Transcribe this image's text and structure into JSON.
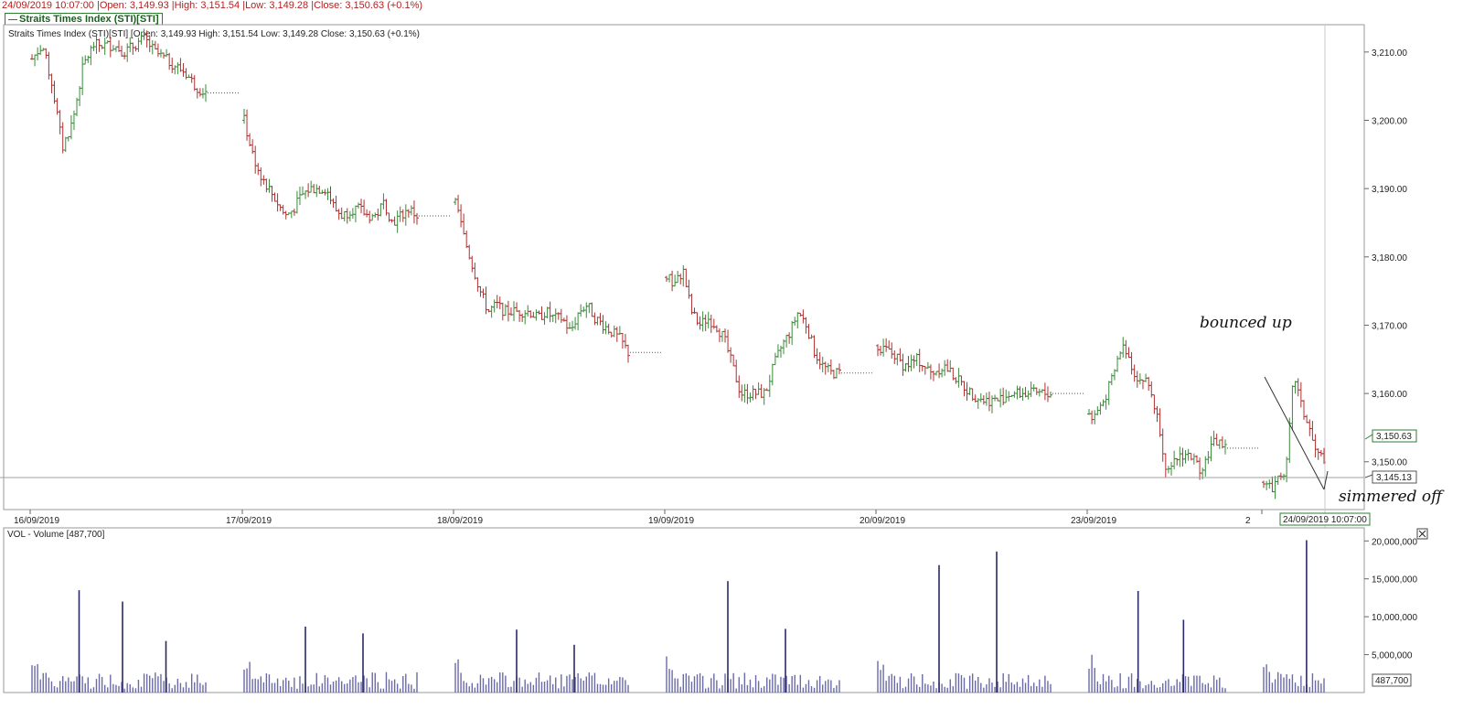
{
  "header": {
    "status_line": "24/09/2019 10:07:00 |Open: 3,149.93 |High: 3,151.54 |Low: 3,149.28 |Close: 3,150.63 (+0.1%)",
    "legend_label": "Straits Times Index (STI)[STI]"
  },
  "colors": {
    "up": "#3a8a3a",
    "down": "#b03030",
    "volume": "#6a6aa8",
    "volume_peak": "#2a2a66",
    "legend": "#2e7d32"
  },
  "chart_data": [
    {
      "type": "ohlc",
      "title": "Straits Times Index (STI)[STI] [Open: 3,149.93  High: 3,151.54  Low: 3,149.28  Close: 3,150.63  (+0.1%)",
      "ylim": [
        3143,
        3214
      ],
      "y_ticks": [
        "3,210.00",
        "3,200.00",
        "3,190.00",
        "3,180.00",
        "3,170.00",
        "3,160.00",
        "3,150.00"
      ],
      "y_tick_values": [
        3210,
        3200,
        3190,
        3180,
        3170,
        3160,
        3150
      ],
      "x_ticks": [
        "16/09/2019",
        "17/09/2019",
        "18/09/2019",
        "19/09/2019",
        "20/09/2019",
        "23/09/2019",
        "2"
      ],
      "days": [
        {
          "label": "16/09/2019",
          "path": [
            3209,
            3211,
            3205,
            3196,
            3200,
            3208,
            3211,
            3211,
            3211,
            3210,
            3211,
            3212,
            3210,
            3209,
            3208,
            3207,
            3205,
            3204
          ]
        },
        {
          "label": "17/09/2019",
          "path": [
            3200,
            3195,
            3192,
            3190,
            3188,
            3186,
            3187,
            3189,
            3190,
            3190,
            3190,
            3187,
            3186,
            3187,
            3187,
            3186,
            3186,
            3188,
            3185,
            3186,
            3187,
            3186
          ]
        },
        {
          "label": "18/09/2019",
          "path": [
            3188,
            3183,
            3179,
            3175,
            3172,
            3173,
            3172,
            3172,
            3172,
            3172,
            3171,
            3172,
            3171,
            3171,
            3169,
            3172,
            3173,
            3171,
            3170,
            3169,
            3168,
            3166
          ]
        },
        {
          "label": "19/09/2019",
          "path": [
            3177,
            3176,
            3178,
            3172,
            3170,
            3171,
            3170,
            3168,
            3164,
            3160,
            3160,
            3160,
            3160,
            3164,
            3167,
            3169,
            3172,
            3170,
            3166,
            3164,
            3163,
            3163
          ]
        },
        {
          "label": "20/09/2019",
          "path": [
            3167,
            3166,
            3164,
            3165,
            3163,
            3164,
            3162,
            3160,
            3159,
            3159,
            3160,
            3160,
            3160,
            3160
          ]
        },
        {
          "label": "23/09/2019",
          "path": [
            3157,
            3156,
            3158,
            3159,
            3161,
            3163,
            3166,
            3167,
            3165,
            3163,
            3162,
            3162,
            3161,
            3158,
            3155,
            3150,
            3148,
            3150,
            3151,
            3151,
            3151,
            3150,
            3149,
            3150,
            3152,
            3153,
            3153,
            3152
          ]
        },
        {
          "label": "2",
          "path": [
            3147,
            3146,
            3148,
            3149,
            3163,
            3158,
            3155,
            3151,
            3150.63
          ]
        }
      ],
      "last_value": "3,150.63",
      "crosshair_value": "3,145.13",
      "crosshair_time": "24/09/2019  10:07:00",
      "annotations": [
        "bounced up",
        "simmered off"
      ]
    },
    {
      "type": "bar",
      "title": "VOL - Volume [487,700]",
      "ylim": [
        0,
        21000000
      ],
      "y_ticks": [
        "20,000,000",
        "15,000,000",
        "10,000,000",
        "5,000,000"
      ],
      "y_tick_values": [
        20000000,
        15000000,
        10000000,
        5000000
      ],
      "last_value": "487,700",
      "notable_volumes": [
        {
          "day": "16/09/2019",
          "values": [
            13500000,
            12000000,
            6800000
          ]
        },
        {
          "day": "17/09/2019",
          "values": [
            8700000,
            7800000
          ]
        },
        {
          "day": "18/09/2019",
          "values": [
            8300000,
            6300000
          ]
        },
        {
          "day": "19/09/2019",
          "values": [
            14700000,
            8400000
          ]
        },
        {
          "day": "20/09/2019",
          "values": [
            16800000,
            18600000
          ]
        },
        {
          "day": "23/09/2019",
          "values": [
            13400000,
            9600000
          ]
        },
        {
          "day": "2",
          "values": [
            20100000
          ]
        }
      ]
    }
  ]
}
